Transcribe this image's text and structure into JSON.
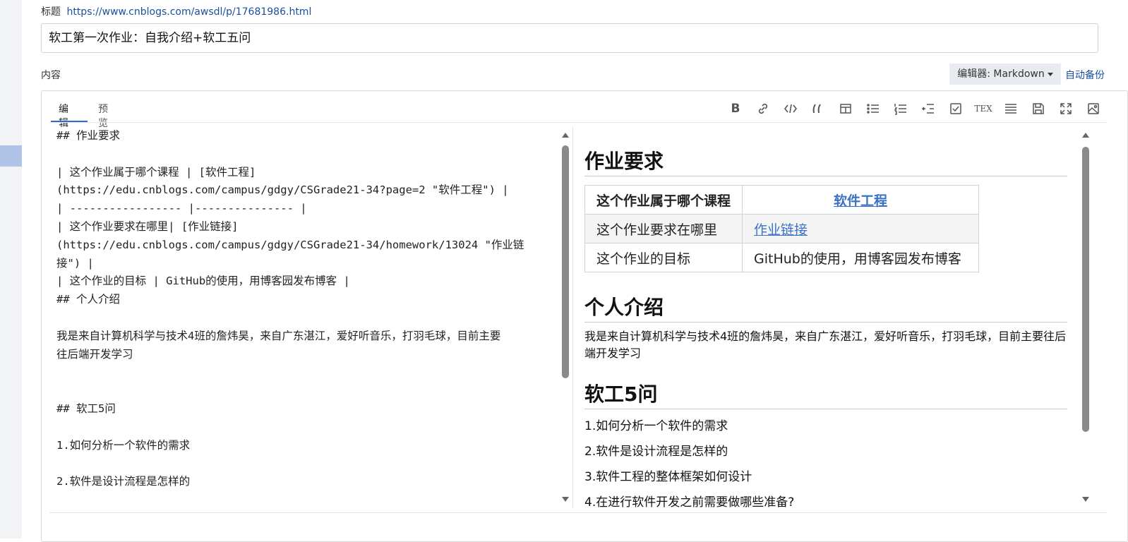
{
  "title_field": {
    "label": "标题",
    "url": "https://www.cnblogs.com/awsdl/p/17681986.html",
    "value": "软工第一次作业：自我介绍+软工五问"
  },
  "content_label": "内容",
  "editor_selector": {
    "label": "编辑器: Markdown"
  },
  "autosave_label": "自动备份",
  "tabs": [
    {
      "label": "编辑"
    },
    {
      "label": "预览"
    }
  ],
  "toolbar": [
    {
      "icon": "bold-icon",
      "glyph": "B"
    },
    {
      "icon": "link-icon"
    },
    {
      "icon": "code-icon"
    },
    {
      "icon": "quote-icon"
    },
    {
      "icon": "table-icon"
    },
    {
      "icon": "unordered-list-icon"
    },
    {
      "icon": "ordered-list-icon"
    },
    {
      "icon": "outline-icon"
    },
    {
      "icon": "checkbox-icon"
    },
    {
      "icon": "tex-icon",
      "glyph": "TEX"
    },
    {
      "icon": "horizontal-rule-icon"
    },
    {
      "icon": "save-icon"
    },
    {
      "icon": "fullscreen-icon"
    },
    {
      "icon": "image-icon"
    }
  ],
  "source_lines": [
    "## 作业要求",
    "",
    "| 这个作业属于哪个课程 | [软件工程]",
    "(https://edu.cnblogs.com/campus/gdgy/CSGrade21-34?page=2 \"软件工程\") |",
    "| ----------------- |--------------- |",
    "| 这个作业要求在哪里| [作业链接]",
    "(https://edu.cnblogs.com/campus/gdgy/CSGrade21-34/homework/13024 \"作业链",
    "接\") |",
    "| 这个作业的目标 | GitHub的使用，用博客园发布博客 |",
    "## 个人介绍",
    "",
    "我是来自计算机科学与技术4班的詹炜昊，来自广东湛江，爱好听音乐，打羽毛球，目前主要",
    "往后端开发学习",
    "",
    "",
    "## 软工5问",
    "",
    "1.如何分析一个软件的需求",
    "",
    "2.软件是设计流程是怎样的"
  ],
  "preview": {
    "h2_requirements": "作业要求",
    "table": {
      "header": {
        "col1": "这个作业属于哪个课程",
        "col2": "软件工程"
      },
      "rows": [
        {
          "col1": "这个作业要求在哪里",
          "col2": "作业链接"
        },
        {
          "col1": "这个作业的目标",
          "col2": "GitHub的使用，用博客园发布博客"
        }
      ]
    },
    "h2_intro": "个人介绍",
    "intro_text": "我是来自计算机科学与技术4班的詹炜昊，来自广东湛江，爱好听音乐，打羽毛球，目前主要往后端开发学习",
    "h2_questions": "软工5问",
    "questions": [
      "1.如何分析一个软件的需求",
      "2.软件是设计流程是怎样的",
      "3.软件工程的整体框架如何设计",
      "4.在进行软件开发之前需要做哪些准备?"
    ]
  },
  "colors": {
    "link": "#1a4fa0",
    "preview_link": "#3a72c4",
    "tab_underline": "#2f6bd0",
    "editor_button_bg": "#e8ecf1"
  }
}
